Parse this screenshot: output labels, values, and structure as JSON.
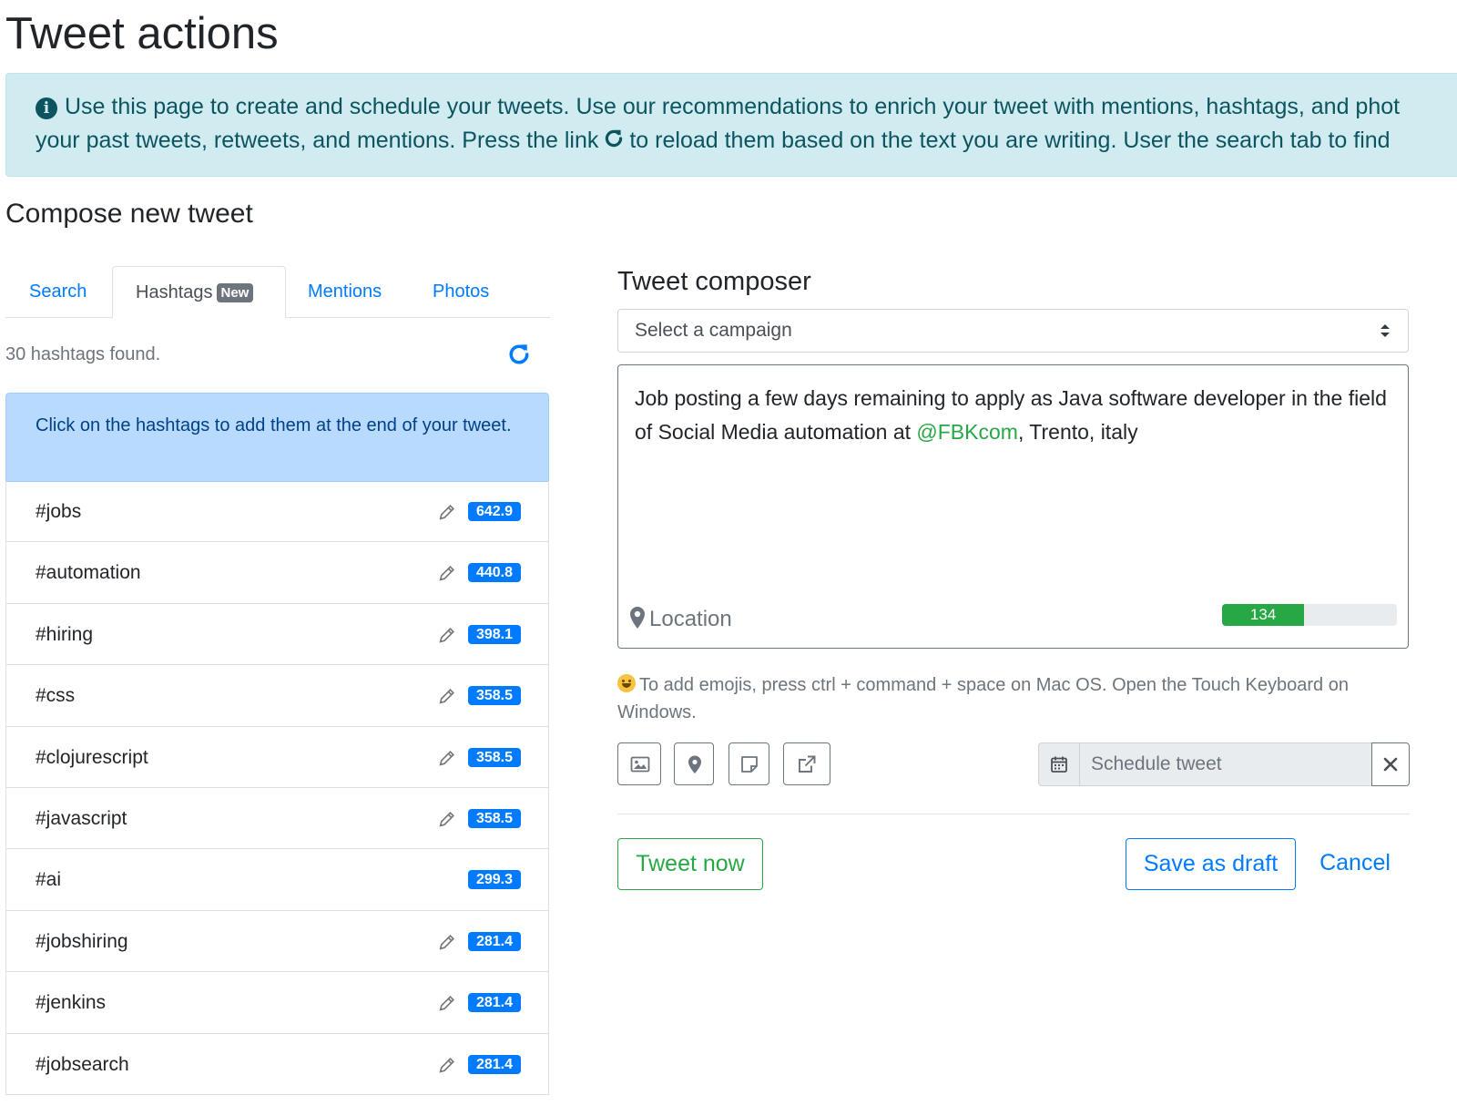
{
  "page": {
    "title": "Tweet actions",
    "info_line1": "Use this page to create and schedule your tweets. Use our recommendations to enrich your tweet with mentions, hashtags, and phot",
    "info_line2a": "your past tweets, retweets, and mentions. Press the link",
    "info_line2b": "to reload them based on the text you are writing. User the search tab to find",
    "section_title": "Compose new tweet"
  },
  "tabs": [
    {
      "label": "Search",
      "active": false
    },
    {
      "label": "Hashtags",
      "active": true,
      "badge": "New"
    },
    {
      "label": "Mentions",
      "active": false
    },
    {
      "label": "Photos",
      "active": false
    }
  ],
  "hashtags_panel": {
    "found_text": "30 hashtags found.",
    "hint": "Click on the hashtags to add them at the end of your tweet.",
    "items": [
      {
        "tag": "#jobs",
        "score": "642.9",
        "editable": true
      },
      {
        "tag": "#automation",
        "score": "440.8",
        "editable": true
      },
      {
        "tag": "#hiring",
        "score": "398.1",
        "editable": true
      },
      {
        "tag": "#css",
        "score": "358.5",
        "editable": true
      },
      {
        "tag": "#clojurescript",
        "score": "358.5",
        "editable": true
      },
      {
        "tag": "#javascript",
        "score": "358.5",
        "editable": true
      },
      {
        "tag": "#ai",
        "score": "299.3",
        "editable": false
      },
      {
        "tag": "#jobshiring",
        "score": "281.4",
        "editable": true
      },
      {
        "tag": "#jenkins",
        "score": "281.4",
        "editable": true
      },
      {
        "tag": "#jobsearch",
        "score": "281.4",
        "editable": true
      }
    ]
  },
  "composer": {
    "title": "Tweet composer",
    "campaign_select": "Select a campaign",
    "tweet_text_before": "Job posting a few days remaining to apply as Java software developer in the field of Social Media automation at ",
    "tweet_mention": "@FBKcom",
    "tweet_text_after": ", Trento, italy",
    "location_label": "Location",
    "chars_remaining": "134",
    "chars_fraction": 0.47,
    "emoji_hint": "To add emojis, press ctrl + command + space on Mac OS. Open the Touch Keyboard on Windows.",
    "toolbar_icons": [
      "image-icon",
      "map-marker-icon",
      "sticky-note-icon",
      "external-link-icon"
    ],
    "schedule_placeholder": "Schedule tweet",
    "buttons": {
      "tweet_now": "Tweet now",
      "save_draft": "Save as draft",
      "cancel": "Cancel"
    }
  },
  "colors": {
    "primary": "#007bff",
    "success": "#28a745",
    "info_bg": "#d1ecf1",
    "hint_bg": "#b8daff"
  }
}
